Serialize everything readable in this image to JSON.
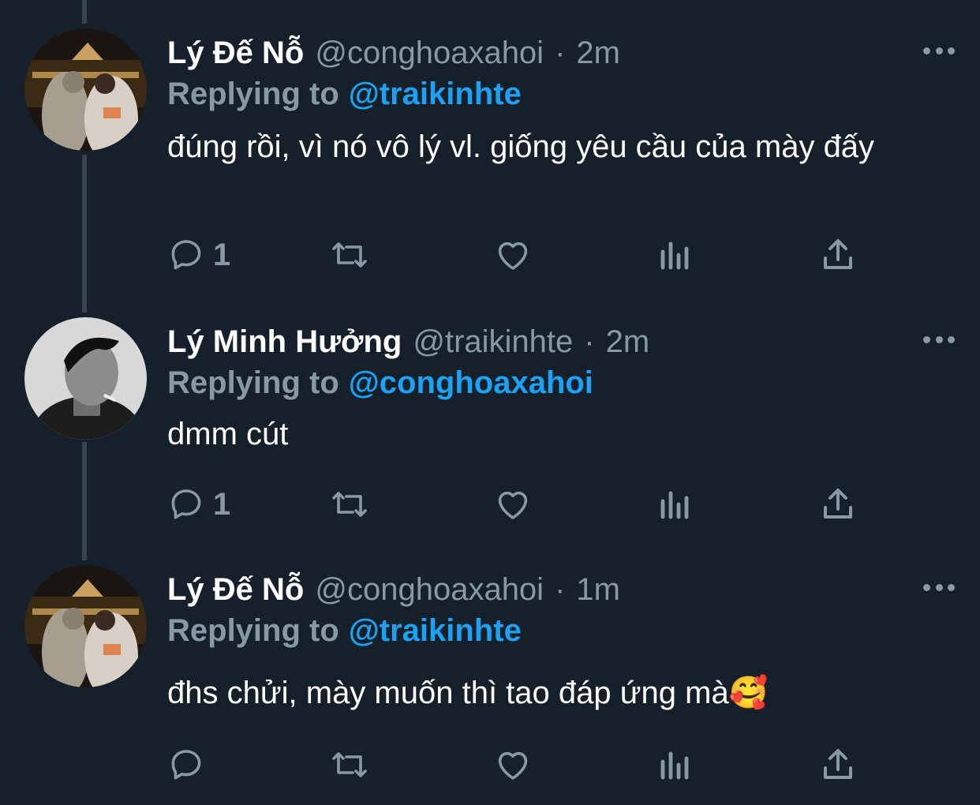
{
  "tweets": [
    {
      "name": "Lý Đế Nỗ",
      "handle": "@conghoaxahoi",
      "separator": "·",
      "time": "2m",
      "replying_label": "Replying to",
      "replying_to": "@traikinhte",
      "text": "đúng rồi, vì nó vô lý vl. giống yêu cầu của mày đấy",
      "reply_count": "1",
      "avatar": "couple-night-photo"
    },
    {
      "name": "Lý Minh Hưởng",
      "handle": "@traikinhte",
      "separator": "·",
      "time": "2m",
      "replying_label": "Replying to",
      "replying_to": "@conghoaxahoi",
      "text": "dmm cút",
      "reply_count": "1",
      "avatar": "bw-portrait-photo"
    },
    {
      "name": "Lý Đế Nỗ",
      "handle": "@conghoaxahoi",
      "separator": "·",
      "time": "1m",
      "replying_label": "Replying to",
      "replying_to": "@traikinhte",
      "text": "đhs chửi, mày muốn thì tao đáp ứng mà🥰",
      "reply_count": "",
      "avatar": "couple-night-photo"
    }
  ],
  "colors": {
    "background": "#15202b",
    "text": "#ffffff",
    "muted": "#8899a6",
    "accent": "#1da1f2",
    "thread_line": "#38444d"
  }
}
